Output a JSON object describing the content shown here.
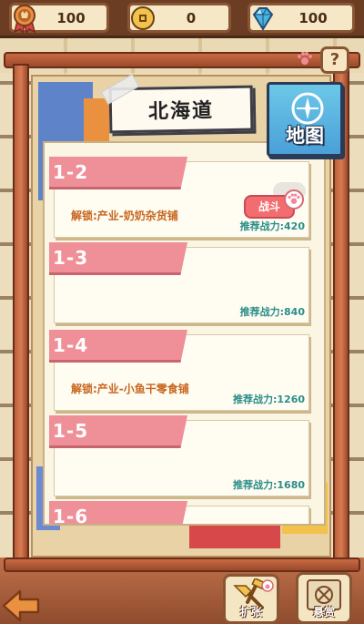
{
  "resources": [
    {
      "icon": "badge-icon",
      "value": "100"
    },
    {
      "icon": "coin-icon",
      "value": "0"
    },
    {
      "icon": "gem-icon",
      "value": "100"
    }
  ],
  "help_label": "?",
  "region_title": "北海道",
  "map_button_label": "地图",
  "levels": [
    {
      "id": "1-2",
      "unlock": "解锁:产业-奶奶杂货铺",
      "power": "推荐战力:420",
      "action": "战斗"
    },
    {
      "id": "1-3",
      "unlock": "",
      "power": "推荐战力:840"
    },
    {
      "id": "1-4",
      "unlock": "解锁:产业-小鱼干零食铺",
      "power": "推荐战力:1260"
    },
    {
      "id": "1-5",
      "unlock": "",
      "power": "推荐战力:1680"
    },
    {
      "id": "1-6",
      "unlock": "",
      "power": ""
    }
  ],
  "bottom": {
    "expand_label": "扩张",
    "bounty_label": "悬赏"
  },
  "colors": {
    "level_tag": "#ef8f98",
    "power_text": "#2b8e8a",
    "unlock_text": "#c8661e",
    "fight_button": "#f36c70",
    "map_button": "#4aa0d8"
  }
}
